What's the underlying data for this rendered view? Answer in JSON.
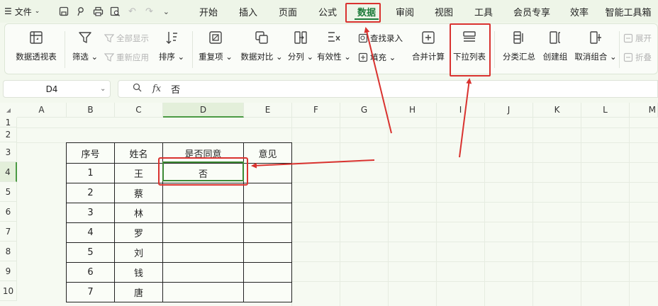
{
  "menu": {
    "file_label": "文件",
    "tabs": [
      "开始",
      "插入",
      "页面",
      "公式",
      "数据",
      "审阅",
      "视图",
      "工具",
      "会员专享",
      "效率",
      "智能工具箱"
    ],
    "active_tab": "数据"
  },
  "ribbon": {
    "pivot": "数据透视表",
    "filter": "筛选",
    "show_all": "全部显示",
    "reapply": "重新应用",
    "sort": "排序",
    "duplicates": "重复项",
    "compare": "数据对比",
    "split": "分列",
    "validity": "有效性",
    "lookup": "查找录入",
    "fill": "填充",
    "consolidate": "合并计算",
    "dropdown": "下拉列表",
    "subtotal": "分类汇总",
    "group": "创建组",
    "ungroup": "取消组合",
    "expand": "展开",
    "collapse": "折叠"
  },
  "formula_bar": {
    "name_box": "D4",
    "fx_label": "fx",
    "value": "否"
  },
  "grid": {
    "columns": [
      "A",
      "B",
      "C",
      "D",
      "E",
      "F",
      "G",
      "H",
      "I",
      "J",
      "K",
      "L",
      "M"
    ],
    "rows": [
      "1",
      "2",
      "3",
      "4",
      "5",
      "6",
      "7",
      "8",
      "9",
      "10"
    ],
    "selected_col": "D",
    "selected_row": "4"
  },
  "table": {
    "headers": [
      "序号",
      "姓名",
      "是否同意",
      "意见"
    ],
    "rows": [
      [
        "1",
        "王",
        "否",
        ""
      ],
      [
        "2",
        "蔡",
        "",
        ""
      ],
      [
        "3",
        "林",
        "",
        ""
      ],
      [
        "4",
        "罗",
        "",
        ""
      ],
      [
        "5",
        "刘",
        "",
        ""
      ],
      [
        "6",
        "钱",
        "",
        ""
      ],
      [
        "7",
        "唐",
        "",
        ""
      ]
    ]
  },
  "colors": {
    "accent": "#1e7b3a",
    "highlight": "#d9322f",
    "selection": "#3c8a35"
  }
}
